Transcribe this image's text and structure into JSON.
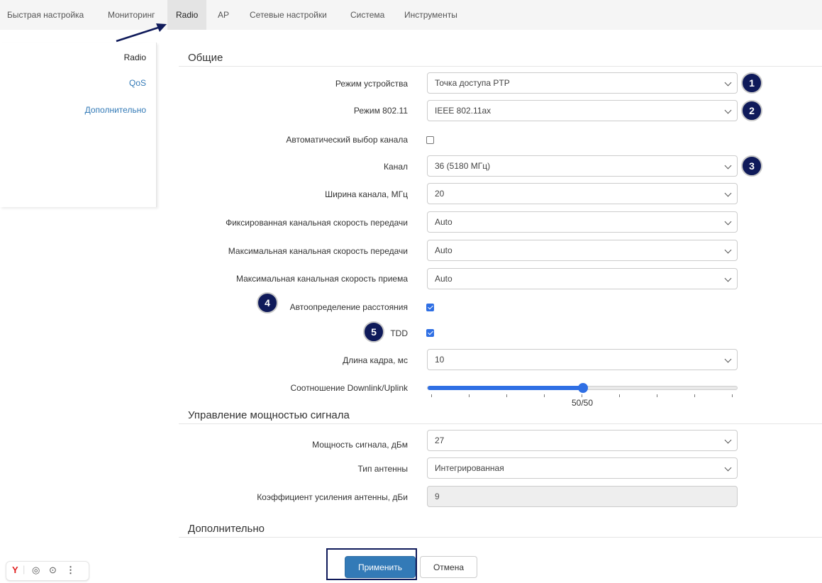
{
  "topnav": {
    "tabs": [
      {
        "label": "Быстрая настройка"
      },
      {
        "label": "Мониторинг"
      },
      {
        "label": "Radio"
      },
      {
        "label": "AP"
      },
      {
        "label": "Сетевые настройки"
      },
      {
        "label": "Система"
      },
      {
        "label": "Инструменты"
      }
    ],
    "active_tab": "Radio"
  },
  "sidebar": {
    "items": [
      {
        "label": "Radio"
      },
      {
        "label": "QoS"
      },
      {
        "label": "Дополнительно"
      }
    ],
    "active_item": "Radio"
  },
  "sections": {
    "general": "Общие",
    "power": "Управление мощностью сигнала",
    "advanced": "Дополнительно"
  },
  "fields": {
    "device_mode": {
      "label": "Режим устройства",
      "value": "Точка доступа PTP"
    },
    "mode_80211": {
      "label": "Режим 802.11",
      "value": "IEEE 802.11ax"
    },
    "auto_channel": {
      "label": "Автоматический выбор канала",
      "checked": false
    },
    "channel": {
      "label": "Канал",
      "value": "36 (5180 МГц)"
    },
    "channel_width": {
      "label": "Ширина канала, МГц",
      "value": "20"
    },
    "fixed_rate": {
      "label": "Фиксированная канальная скорость передачи",
      "value": "Auto"
    },
    "max_tx_rate": {
      "label": "Максимальная канальная скорость передачи",
      "value": "Auto"
    },
    "max_rx_rate": {
      "label": "Максимальная канальная скорость приема",
      "value": "Auto"
    },
    "auto_distance": {
      "label": "Автоопределение расстояния",
      "checked": true
    },
    "tdd": {
      "label": "TDD",
      "checked": true
    },
    "frame_length": {
      "label": "Длина кадра, мс",
      "value": "10"
    },
    "dl_ul_ratio": {
      "label": "Соотношение Downlink/Uplink",
      "value_text": "50/50",
      "fraction": 0.5
    },
    "tx_power": {
      "label": "Мощность сигнала, дБм",
      "value": "27"
    },
    "antenna_type": {
      "label": "Тип антенны",
      "value": "Интегрированная"
    },
    "antenna_gain": {
      "label": "Коэффициент усиления антенны, дБи",
      "value": "9"
    }
  },
  "badges": [
    "1",
    "2",
    "3",
    "4",
    "5"
  ],
  "buttons": {
    "apply": "Применить",
    "cancel": "Отмена"
  },
  "colors": {
    "accent": "#2f6fe4",
    "primary_button": "#337ab7",
    "annotation": "#0f1a5a"
  }
}
